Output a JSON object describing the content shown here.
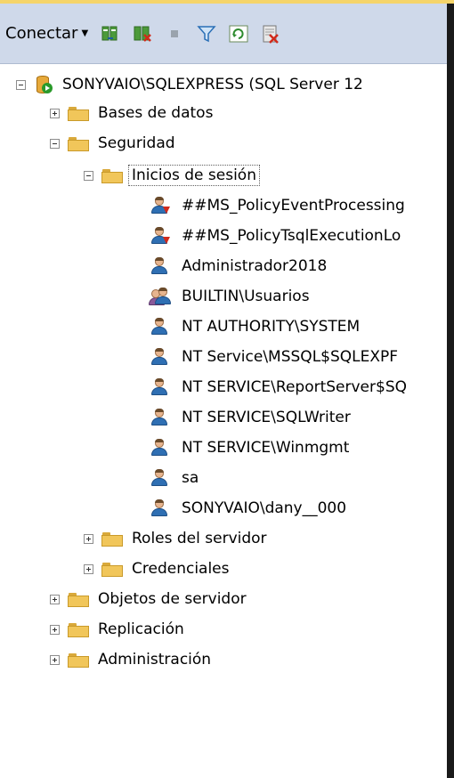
{
  "toolbar": {
    "connect_label": "Conectar",
    "connect_dropdown_icon": "triangle-down",
    "icons": [
      "connect-object-explorer-icon",
      "disconnect-icon",
      "stop-icon",
      "filter-icon",
      "refresh-icon",
      "disconnect-all-icon"
    ]
  },
  "tree": {
    "server": "SONYVAIO\\SQLEXPRESS (SQL Server 12",
    "databases": "Bases de datos",
    "security": "Seguridad",
    "logins": "Inicios de sesión",
    "login_items": [
      "##MS_PolicyEventProcessing",
      "##MS_PolicyTsqlExecutionLo",
      "Administrador2018",
      "BUILTIN\\Usuarios",
      "NT AUTHORITY\\SYSTEM",
      "NT Service\\MSSQL$SQLEXPF",
      "NT SERVICE\\ReportServer$SQ",
      "NT SERVICE\\SQLWriter",
      "NT SERVICE\\Winmgmt",
      "sa",
      "SONYVAIO\\dany__000"
    ],
    "server_roles": "Roles del servidor",
    "credentials": "Credenciales",
    "server_objects": "Objetos de servidor",
    "replication": "Replicación",
    "administration": "Administración"
  },
  "colors": {
    "toolbar_bg": "#cfd9ea",
    "folder": "#f1c65a",
    "user_body": "#2f6fb3"
  }
}
